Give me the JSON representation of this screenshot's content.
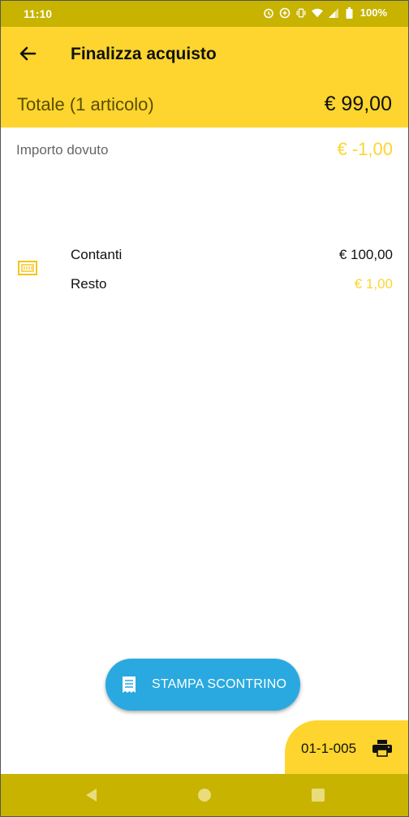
{
  "status_bar": {
    "time": "11:10",
    "battery": "100%",
    "icons": [
      "alarm-icon",
      "data-saver-icon",
      "vibrate-icon",
      "wifi-icon",
      "signal-icon",
      "battery-icon"
    ]
  },
  "app_bar": {
    "title": "Finalizza acquisto",
    "back_icon": "arrow-back-icon"
  },
  "totals": {
    "label": "Totale (1 articolo)",
    "amount": "€ 99,00"
  },
  "due": {
    "label": "Importo dovuto",
    "amount": "€ -1,00"
  },
  "payment": {
    "icon": "cash-icon",
    "method_label": "Contanti",
    "method_amount": "€ 100,00",
    "change_label": "Resto",
    "change_amount": "€ 1,00"
  },
  "print_button": {
    "label": "STAMPA SCONTRINO",
    "icon": "receipt-icon"
  },
  "printer": {
    "id": "01-1-005",
    "icon": "printer-icon"
  },
  "nav_bar": {
    "buttons": [
      "back-triangle",
      "home-circle",
      "recents-square"
    ]
  },
  "colors": {
    "accent_yellow": "#fdd52e",
    "dark_yellow": "#c7b300",
    "fab_blue": "#29a9e0"
  }
}
